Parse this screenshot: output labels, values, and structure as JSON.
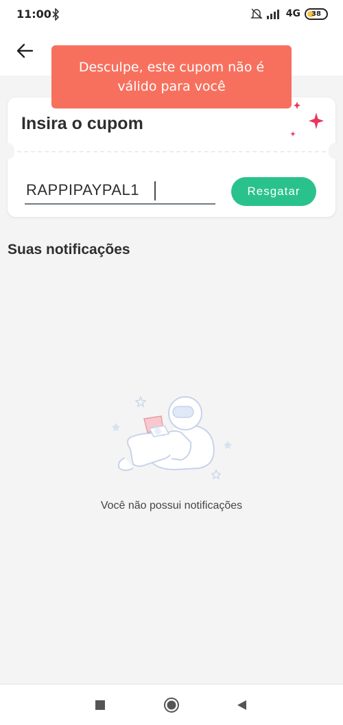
{
  "status_bar": {
    "time": "11:00",
    "network": "4G",
    "battery": "38",
    "icons": [
      "bluetooth-icon",
      "alarm-off-icon",
      "signal-icon",
      "battery-icon"
    ]
  },
  "toast": {
    "message": "Desculpe, este cupom não é válido para você",
    "color": "#f7705e"
  },
  "coupon": {
    "title": "Insira o cupom",
    "input_value": "RAPPIPAYPAL1",
    "redeem_label": "Resgatar",
    "accent_color": "#2ac28c",
    "sparkle_color": "#e8365d"
  },
  "notifications": {
    "section_title": "Suas notificações",
    "empty_text": "Você não possui notificações",
    "illustration": "astronaut-illustration"
  },
  "nav": {
    "buttons": [
      "recent-apps-icon",
      "home-icon",
      "back-icon"
    ]
  }
}
